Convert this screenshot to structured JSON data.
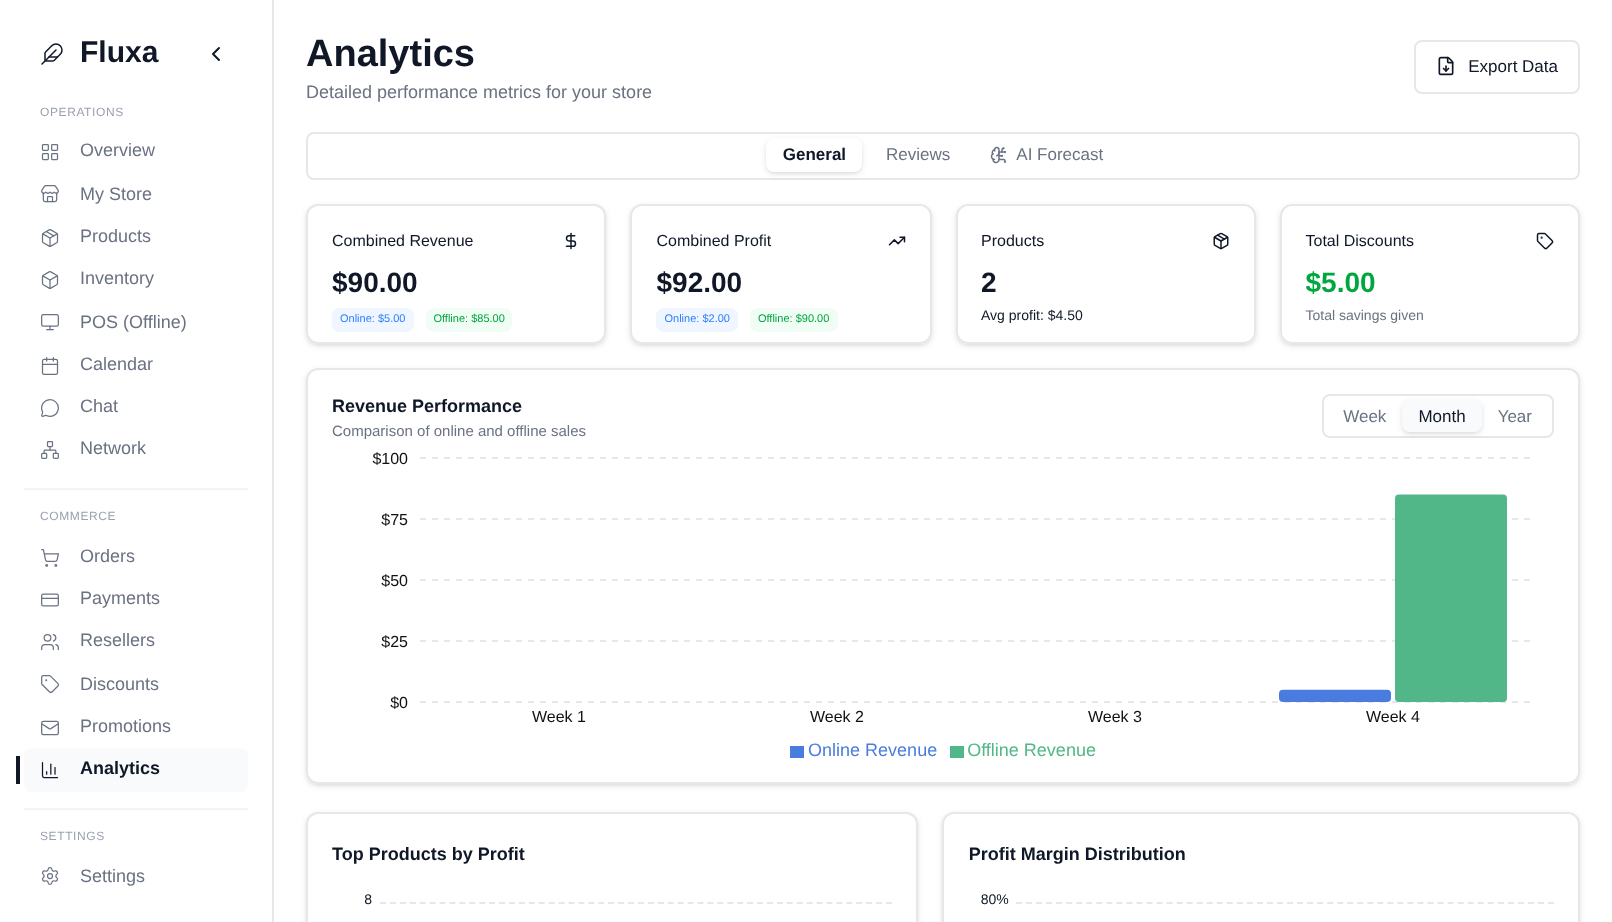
{
  "sidebar": {
    "brand": "Fluxa",
    "sections": [
      {
        "title": "OPERATIONS",
        "items": [
          {
            "label": "Overview",
            "selected": false
          },
          {
            "label": "My Store",
            "selected": false
          },
          {
            "label": "Products",
            "selected": false
          },
          {
            "label": "Inventory",
            "selected": false
          },
          {
            "label": "POS (Offline)",
            "selected": false
          },
          {
            "label": "Calendar",
            "selected": false
          },
          {
            "label": "Chat",
            "selected": false
          },
          {
            "label": "Network",
            "selected": false
          }
        ]
      },
      {
        "title": "COMMERCE",
        "items": [
          {
            "label": "Orders",
            "selected": false
          },
          {
            "label": "Payments",
            "selected": false
          },
          {
            "label": "Resellers",
            "selected": false
          },
          {
            "label": "Discounts",
            "selected": false
          },
          {
            "label": "Promotions",
            "selected": false
          },
          {
            "label": "Analytics",
            "selected": true
          }
        ]
      },
      {
        "title": "SETTINGS",
        "items": [
          {
            "label": "Settings",
            "selected": false
          }
        ]
      }
    ]
  },
  "header": {
    "title": "Analytics",
    "subtitle": "Detailed performance metrics for your store",
    "export_button": "Export Data"
  },
  "tabs": [
    {
      "label": "General",
      "selected": true
    },
    {
      "label": "Reviews",
      "selected": false
    },
    {
      "label": "AI Forecast",
      "selected": false
    }
  ],
  "stats": [
    {
      "kind": "split",
      "title": "Combined Revenue",
      "value": "$90.00",
      "online": "Online: $5.00",
      "offline": "Offline: $85.00"
    },
    {
      "kind": "split",
      "title": "Combined Profit",
      "value": "$92.00",
      "online": "Online: $2.00",
      "offline": "Offline: $90.00"
    },
    {
      "kind": "note",
      "title": "Products",
      "value": "2",
      "note": "Avg profit: $4.50"
    },
    {
      "kind": "highlight",
      "title": "Total Discounts",
      "value": "$5.00",
      "note": "Total savings given"
    }
  ],
  "revenue": {
    "title": "Revenue Performance",
    "subtitle": "Comparison of online and offline sales",
    "periods": [
      {
        "label": "Week",
        "selected": false
      },
      {
        "label": "Month",
        "selected": true
      },
      {
        "label": "Year",
        "selected": false
      }
    ],
    "chart_data": {
      "type": "bar",
      "grid": true,
      "categories": [
        "Week 1",
        "Week 2",
        "Week 3",
        "Week 4"
      ],
      "ylim": [
        0,
        100
      ],
      "yticks": [
        {
          "value": 0,
          "label": "$0"
        },
        {
          "value": 25,
          "label": "$25"
        },
        {
          "value": 50,
          "label": "$50"
        },
        {
          "value": 75,
          "label": "$75"
        },
        {
          "value": 100,
          "label": "$100"
        }
      ],
      "series": [
        {
          "name": "Online Revenue",
          "color": "#4a7ce0",
          "values": [
            0,
            0,
            0,
            5
          ]
        },
        {
          "name": "Offline Revenue",
          "color": "#52b788",
          "values": [
            0,
            0,
            0,
            85
          ]
        }
      ]
    }
  },
  "bottom_cards": [
    {
      "title": "Top Products by Profit",
      "axis_top_label": "8"
    },
    {
      "title": "Profit Margin Distribution",
      "axis_top_label": "80%"
    }
  ]
}
